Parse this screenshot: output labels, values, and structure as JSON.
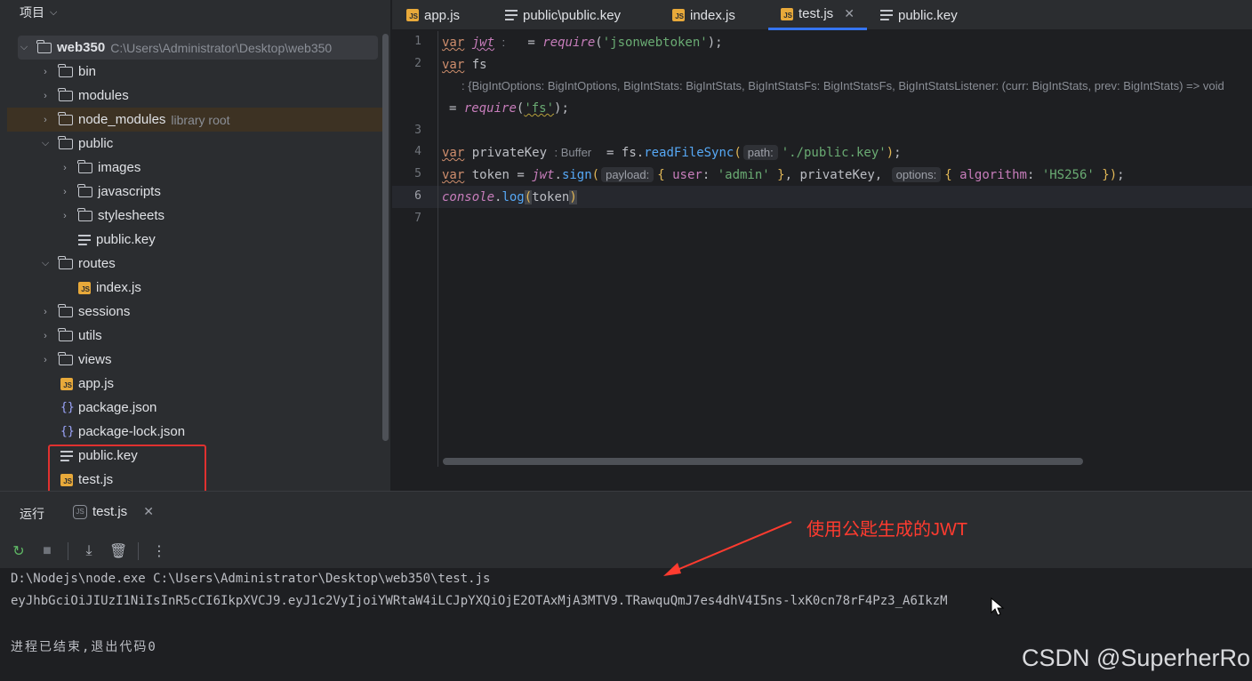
{
  "project": {
    "header": "项目",
    "items": [
      {
        "label": "web350",
        "path": "C:\\Users\\Administrator\\Desktop\\web350"
      },
      {
        "label": "bin"
      },
      {
        "label": "modules"
      },
      {
        "label": "node_modules",
        "note": "library root"
      },
      {
        "label": "public"
      },
      {
        "label": "images"
      },
      {
        "label": "javascripts"
      },
      {
        "label": "stylesheets"
      },
      {
        "label": "public.key"
      },
      {
        "label": "routes"
      },
      {
        "label": "index.js"
      },
      {
        "label": "sessions"
      },
      {
        "label": "utils"
      },
      {
        "label": "views"
      },
      {
        "label": "app.js"
      },
      {
        "label": "package.json"
      },
      {
        "label": "package-lock.json"
      },
      {
        "label": "public.key"
      },
      {
        "label": "test.js"
      }
    ]
  },
  "tabs": [
    {
      "label": "app.js",
      "icon": "js-file-icon"
    },
    {
      "label": "public\\public.key",
      "icon": "text-file-icon"
    },
    {
      "label": "index.js",
      "icon": "js-file-icon"
    },
    {
      "label": "test.js",
      "icon": "js-file-icon",
      "active": true
    },
    {
      "label": "public.key",
      "icon": "text-file-icon"
    }
  ],
  "editor": {
    "line_numbers": [
      "1",
      "2",
      "3",
      "4",
      "5",
      "6",
      "7"
    ],
    "current_line": "6",
    "hints": {
      "jwt_type": ":",
      "fs_type": ": {BigIntOptions: BigIntOptions, BigIntStats: BigIntStats, BigIntStatsFs: BigIntStatsFs, BigIntStatsListener: (curr: BigIntStats, prev: BigIntStats) => void",
      "privatekey_type": ": Buffer",
      "path_param": "path:",
      "payload_param": "payload:",
      "options_param": "options:"
    },
    "tokens": {
      "var": "var",
      "jwt": "jwt",
      "eq": "=",
      "require": "require",
      "paren_open": "(",
      "paren_close": ")",
      "semi": ";",
      "jsonwebtoken": "'jsonwebtoken'",
      "fs": "fs",
      "fs_str": "'fs'",
      "privateKey": "privateKey",
      "fs_dot": "fs.",
      "readFileSync": "readFileSync",
      "key_path": "'./public.key'",
      "token": "token",
      "jwt_dot": ".",
      "sign": "sign",
      "brace_open": "{",
      "brace_close": "}",
      "user": "user",
      "colon": ":",
      "admin": "'admin'",
      "comma": ",",
      "algorithm": "algorithm",
      "hs256": "'HS256'",
      "console": "console",
      "dot": ".",
      "log": "log"
    }
  },
  "run": {
    "title": "运行",
    "tab_label": "test.js",
    "console_lines": [
      "D:\\Nodejs\\node.exe C:\\Users\\Administrator\\Desktop\\web350\\test.js",
      "eyJhbGciOiJIUzI1NiIsInR5cCI6IkpXVCJ9.eyJ1c2VyIjoiYWRtaW4iLCJpYXQiOjE2OTAxMjA3MTV9.TRawquQmJ7es4dhV4I5ns-lxK0cn78rF4Pz3_A6IkzM",
      "",
      "进程已结束,退出代码0"
    ]
  },
  "annotation": "使用公匙生成的JWT",
  "watermark": "CSDN @SuperherRo"
}
